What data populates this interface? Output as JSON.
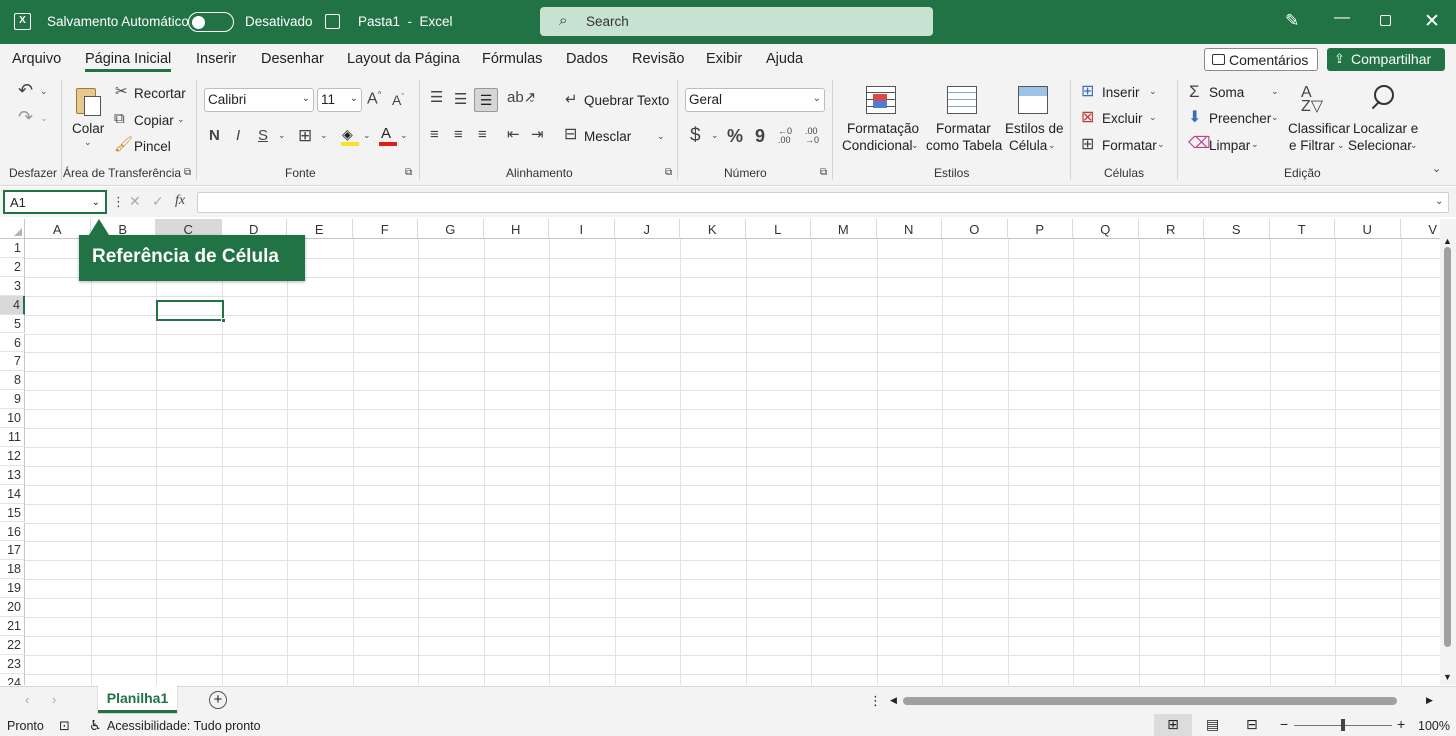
{
  "titlebar": {
    "autosave_label": "Salvamento Automático",
    "autosave_state": "Desativado",
    "doc_title": "Pasta1  -  Excel",
    "search_placeholder": "Search",
    "color": "#217346"
  },
  "menu": {
    "tabs": [
      "Arquivo",
      "Página Inicial",
      "Inserir",
      "Desenhar",
      "Layout da Página",
      "Fórmulas",
      "Dados",
      "Revisão",
      "Exibir",
      "Ajuda"
    ],
    "active": "Página Inicial",
    "comments": "Comentários",
    "share": "Compartilhar"
  },
  "ribbon": {
    "undo": {
      "group": "Desfazer"
    },
    "clipboard": {
      "paste": "Colar",
      "cut": "Recortar",
      "copy": "Copiar",
      "painter": "Pincel",
      "group": "Área de Transferência"
    },
    "font": {
      "name": "Calibri",
      "size": "11",
      "bold": "N",
      "italic": "I",
      "underline": "S",
      "group": "Fonte"
    },
    "alignment": {
      "wrap": "Quebrar Texto",
      "merge": "Mesclar",
      "group": "Alinhamento"
    },
    "number": {
      "format": "Geral",
      "currency": "$",
      "percent": "%",
      "comma": "9",
      "group": "Número"
    },
    "styles": {
      "conditional_1": "Formatação",
      "conditional_2": "Condicional",
      "table_1": "Formatar",
      "table_2": "como Tabela",
      "cell_1": "Estilos de",
      "cell_2": "Célula",
      "group": "Estilos"
    },
    "cells": {
      "insert": "Inserir",
      "delete": "Excluir",
      "format": "Formatar",
      "group": "Células"
    },
    "editing": {
      "sum": "Soma",
      "fill": "Preencher",
      "clear": "Limpar",
      "sort_1": "Classificar",
      "sort_2": "e Filtrar",
      "find_1": "Localizar e",
      "find_2": "Selecionar",
      "group": "Edição"
    }
  },
  "formula_bar": {
    "name_box": "A1",
    "fx": "fx"
  },
  "grid": {
    "columns": [
      "A",
      "B",
      "C",
      "D",
      "E",
      "F",
      "G",
      "H",
      "I",
      "J",
      "K",
      "L",
      "M",
      "N",
      "O",
      "P",
      "Q",
      "R",
      "S",
      "T",
      "U",
      "V"
    ],
    "rows": [
      "1",
      "2",
      "3",
      "4",
      "5",
      "6",
      "7",
      "8",
      "9",
      "10",
      "11",
      "12",
      "13",
      "14",
      "15",
      "16",
      "17",
      "18",
      "19",
      "20",
      "21",
      "22",
      "23",
      "24"
    ],
    "selected_cell": "C4",
    "callout": "Referência de Célula"
  },
  "sheets": {
    "tabs": [
      "Planilha1"
    ]
  },
  "status": {
    "ready": "Pronto",
    "accessibility": "Acessibilidade: Tudo pronto",
    "zoom": "100%"
  }
}
